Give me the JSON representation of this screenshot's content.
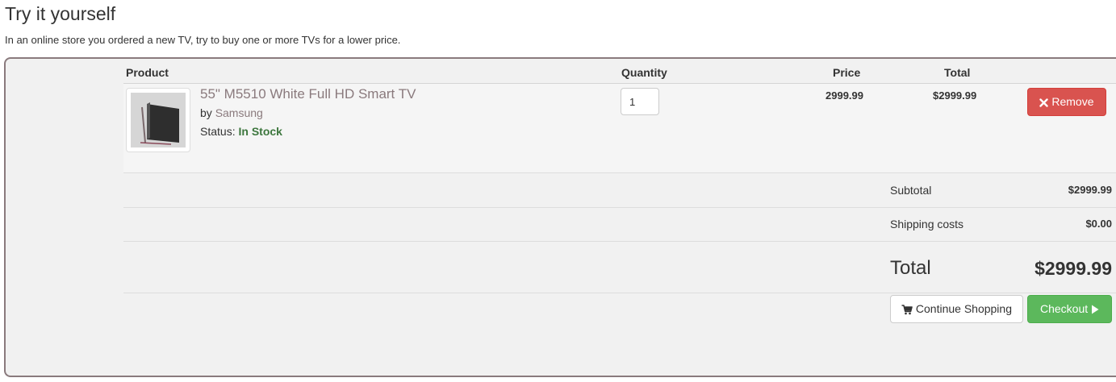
{
  "page": {
    "title": "Try it yourself",
    "intro": "In an online store you ordered a new TV, try to buy one or more TVs for a lower price."
  },
  "cart": {
    "columns": {
      "product": "Product",
      "quantity": "Quantity",
      "price": "Price",
      "total": "Total"
    },
    "item": {
      "name": "55\" M5510 White Full HD Smart TV",
      "by_prefix": "by",
      "brand": "Samsung",
      "status_prefix": "Status:",
      "status": "In Stock",
      "quantity": "1",
      "price": "2999.99",
      "total": "$2999.99",
      "remove_label": "Remove",
      "image_icon": "tv-image"
    },
    "summary": {
      "subtotal_label": "Subtotal",
      "subtotal_value": "$2999.99",
      "shipping_label": "Shipping costs",
      "shipping_value": "$0.00",
      "total_label": "Total",
      "total_value": "$2999.99"
    },
    "actions": {
      "continue_label": "Continue Shopping",
      "continue_icon": "shopping-cart-icon",
      "checkout_label": "Checkout",
      "checkout_icon": "play-icon"
    }
  },
  "colors": {
    "remove": "#d9534f",
    "checkout": "#5cb85c",
    "in_stock": "#3c763d",
    "link": "#8a7a7d"
  }
}
